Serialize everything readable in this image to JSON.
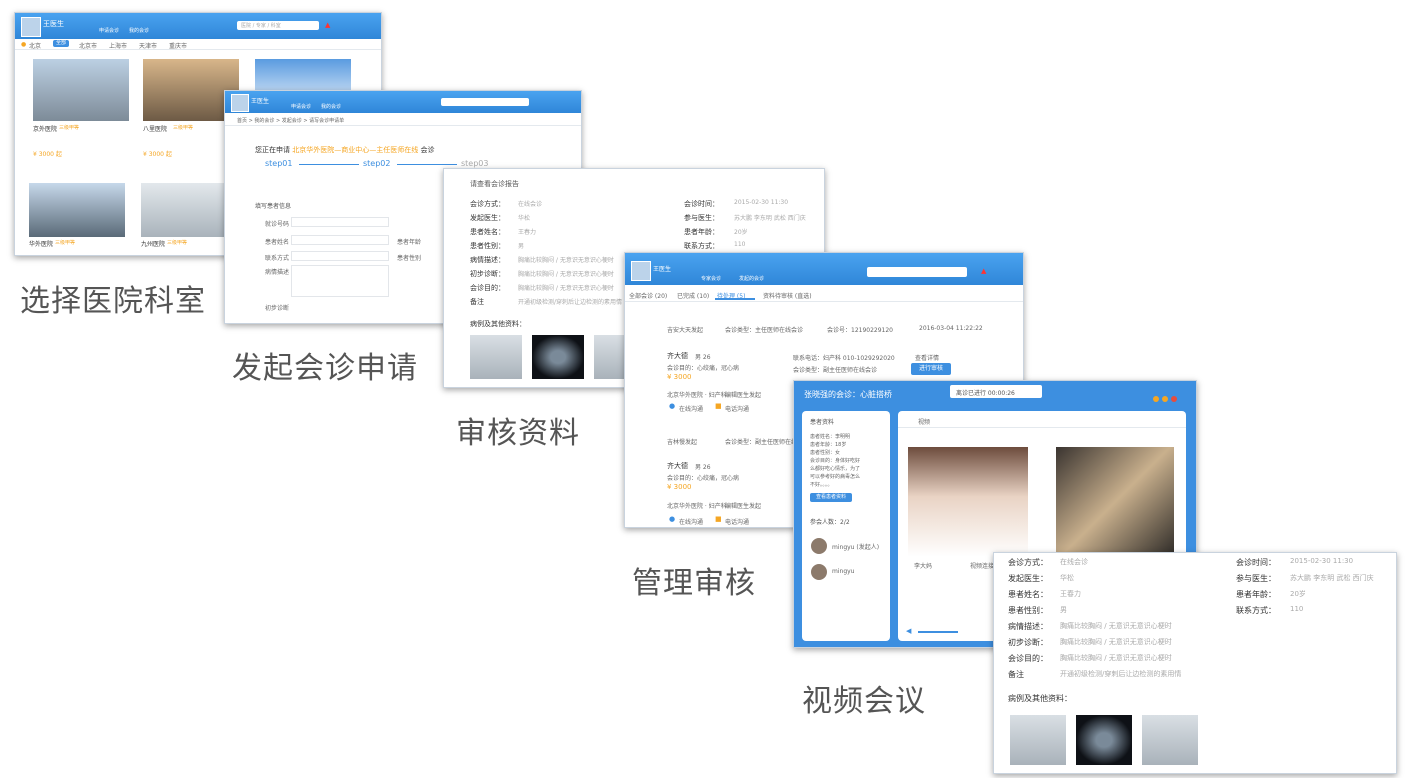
{
  "steps": [
    {
      "caption": "选择医院科室"
    },
    {
      "caption": "发起会诊申请"
    },
    {
      "caption": "审核资料"
    },
    {
      "caption": "管理审核"
    },
    {
      "caption": "视频会议"
    }
  ],
  "shot1": {
    "user": "王医生",
    "nav": [
      "申请会诊",
      "我的会诊"
    ],
    "search_placeholder": "医院 / 专家 / 科室",
    "filter_label": "北京",
    "filter_tabs": [
      "全部",
      "北京市",
      "上海市",
      "天津市",
      "重庆市"
    ],
    "hospitals": [
      {
        "name": "京外医院",
        "tag": "三级甲等",
        "price": "¥ 3000 起"
      },
      {
        "name": "八里医院",
        "tag": "三级甲等",
        "price": "¥ 3000 起"
      },
      {
        "name": "华外医院",
        "tag": "三级甲等",
        "price": ""
      },
      {
        "name": "九州医院",
        "tag": "三级甲等",
        "price": ""
      }
    ]
  },
  "shot2": {
    "user": "王医生",
    "nav": [
      "申请会诊",
      "我的会诊"
    ],
    "breadcrumb": "首页 > 我的会诊 > 发起会诊 > 请写会诊申请单",
    "heading_prefix": "您正在申请",
    "heading_highlight": "北京华外医院—商业中心—主任医师在线",
    "heading_suffix": "会诊",
    "steps": [
      "step01",
      "step02",
      "step03"
    ],
    "form_title": "填写患者信息",
    "fields": [
      "就诊号码",
      "患者姓名",
      "联系方式",
      "病情描述",
      "初步诊断"
    ],
    "fields_right": [
      "患者年龄",
      "患者性别"
    ]
  },
  "shot3": {
    "title": "请查看会诊报告",
    "rows_left": [
      {
        "label": "会诊方式：",
        "value": "在线会诊"
      },
      {
        "label": "发起医生：",
        "value": "华松"
      },
      {
        "label": "患者姓名：",
        "value": "王春力"
      },
      {
        "label": "患者性别：",
        "value": "男"
      },
      {
        "label": "病情描述：",
        "value": "胸痛比较胸闷 / 无意识无意识心梗时"
      },
      {
        "label": "初步诊断：",
        "value": "胸痛比较胸闷 / 无意识无意识心梗时"
      },
      {
        "label": "会诊目的：",
        "value": "胸痛比较胸闷 / 无意识无意识心梗时"
      },
      {
        "label": "备注",
        "value": "开通初级检测/穿刺后让边检测的素用情"
      }
    ],
    "rows_right": [
      {
        "label": "会诊时间：",
        "value": "2015-02-30  11:30"
      },
      {
        "label": "参与医生：",
        "value": "苏大鹏 李东明 武松 西门庆"
      },
      {
        "label": "患者年龄：",
        "value": "20岁"
      },
      {
        "label": "联系方式：",
        "value": "110"
      }
    ],
    "attachments_title": "病例及其他资料："
  },
  "shot4": {
    "user": "王医生",
    "nav": [
      "专家会诊",
      "发起的会诊"
    ],
    "tabs": [
      "全部会诊 (20)",
      "已完成 (10)",
      "待处理 (5)",
      "资料待审核 (直选)"
    ],
    "records": [
      {
        "initiator": "吉安大天发起",
        "type": "会诊类型：主任医师在线会诊",
        "number": "会诊号：12190229120",
        "date": "2016-03-04  11:22:22",
        "patient": "齐大德",
        "age": "男 26",
        "purpose": "会诊目的：心绞痛，冠心病",
        "price": "¥ 3000",
        "hospital": "北京华外医院 · 妇产科",
        "doctor": "编辑医生发起",
        "phone": "联系电话：妇产科 010-1029292020",
        "status": "会诊类型：副主任医师在线会诊",
        "view": "查看详情",
        "audit": "进行审核",
        "chat": "在线沟通",
        "call": "电话沟通"
      },
      {
        "initiator": "吉林慢发起",
        "type": "会诊类型：副主任医师在线会诊",
        "patient": "齐大德",
        "age": "男 26",
        "purpose": "会诊目的：心绞痛，冠心病",
        "price": "¥ 3000",
        "hospital": "北京华外医院 · 妇产科",
        "doctor": "编辑医生发起",
        "chat": "在线沟通",
        "call": "电话沟通"
      }
    ]
  },
  "shot5": {
    "title": "张晓强的会诊：心脏搭桥",
    "timer": "离诊已进行 00:00:26",
    "panel_title": "患者资料",
    "patient_lines": [
      "患者姓名：李明明",
      "患者年龄：18岁",
      "患者性别：女",
      "会诊目的：身体好吃好",
      "么都好吃心情乐，为了",
      "可以参考好的病毒怎么",
      "不好。。。。"
    ],
    "view_button": "查看患者资料",
    "members_label": "参会人数：2/2",
    "members": [
      "mingyu (发起人)",
      "mingyu"
    ],
    "video_tab": "视频",
    "video_names": [
      "李大妈",
      "视频连接中"
    ]
  },
  "shot6": {
    "rows_left": [
      {
        "label": "会诊方式：",
        "value": "在线会诊"
      },
      {
        "label": "发起医生：",
        "value": "华松"
      },
      {
        "label": "患者姓名：",
        "value": "王春力"
      },
      {
        "label": "患者性别：",
        "value": "男"
      },
      {
        "label": "病情描述：",
        "value": "胸痛比较胸闷 / 无意识无意识心梗时"
      },
      {
        "label": "初步诊断：",
        "value": "胸痛比较胸闷 / 无意识无意识心梗时"
      },
      {
        "label": "会诊目的：",
        "value": "胸痛比较胸闷 / 无意识无意识心梗时"
      },
      {
        "label": "备注",
        "value": "开通初级检测/穿刺后让边检测的素用情"
      }
    ],
    "rows_right": [
      {
        "label": "会诊时间：",
        "value": "2015-02-30  11:30"
      },
      {
        "label": "参与医生：",
        "value": "苏大鹏 李东明 武松 西门庆"
      },
      {
        "label": "患者年龄：",
        "value": "20岁"
      },
      {
        "label": "联系方式：",
        "value": "110"
      }
    ],
    "attachments_title": "病例及其他资料："
  },
  "colors": {
    "brand": "#3d8fe0",
    "accent": "#f5a623"
  }
}
